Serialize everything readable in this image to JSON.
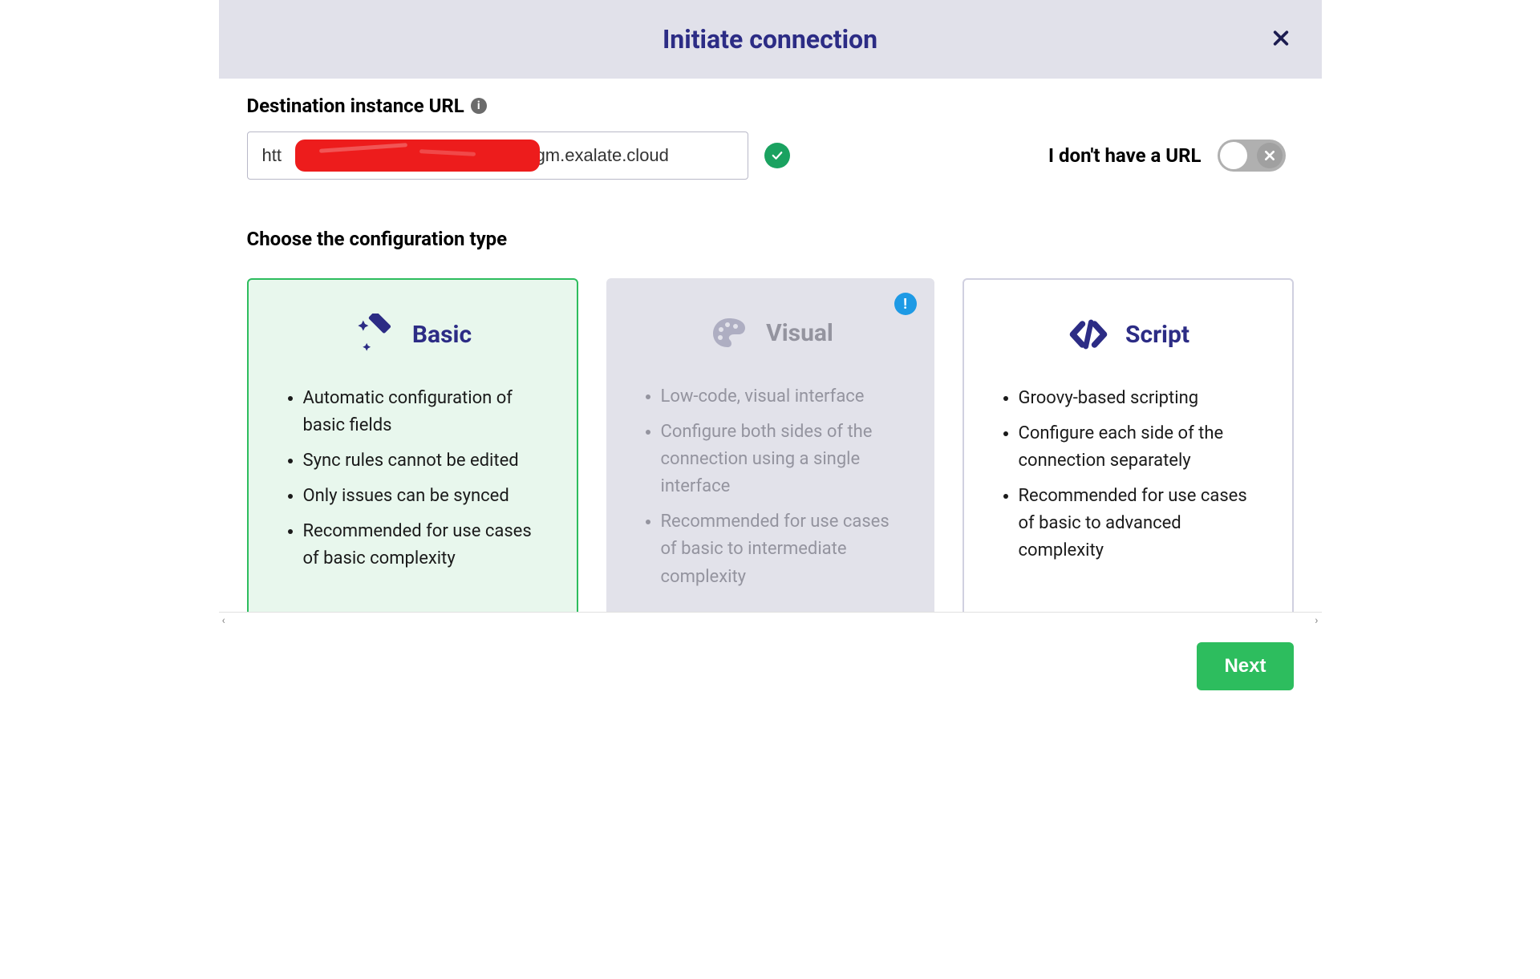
{
  "header": {
    "title": "Initiate connection"
  },
  "url_section": {
    "label": "Destination instance URL",
    "value_prefix": "htt",
    "value_suffix": "pl-yfgm.exalate.cloud",
    "validated": true
  },
  "no_url": {
    "label": "I don't have a URL",
    "enabled": false
  },
  "config_section": {
    "title": "Choose the configuration type",
    "cards": [
      {
        "key": "basic",
        "title": "Basic",
        "state": "selected",
        "icon": "wand-icon",
        "bullets": [
          "Automatic configuration of basic fields",
          "Sync rules cannot be edited",
          "Only issues can be synced",
          "Recommended for use cases of basic complexity"
        ]
      },
      {
        "key": "visual",
        "title": "Visual",
        "state": "disabled",
        "icon": "palette-icon",
        "has_alert": true,
        "bullets": [
          "Low-code, visual interface",
          "Configure both sides of the connection using a single interface",
          "Recommended for use cases of basic to intermediate complexity"
        ]
      },
      {
        "key": "script",
        "title": "Script",
        "state": "normal",
        "icon": "code-icon",
        "bullets": [
          "Groovy-based scripting",
          "Configure each side of the connection separately",
          "Recommended for use cases of basic to advanced complexity"
        ]
      }
    ]
  },
  "footer": {
    "next": "Next"
  },
  "meta": {
    "info_glyph": "i",
    "alert_glyph": "!",
    "close_glyph": "✕"
  }
}
